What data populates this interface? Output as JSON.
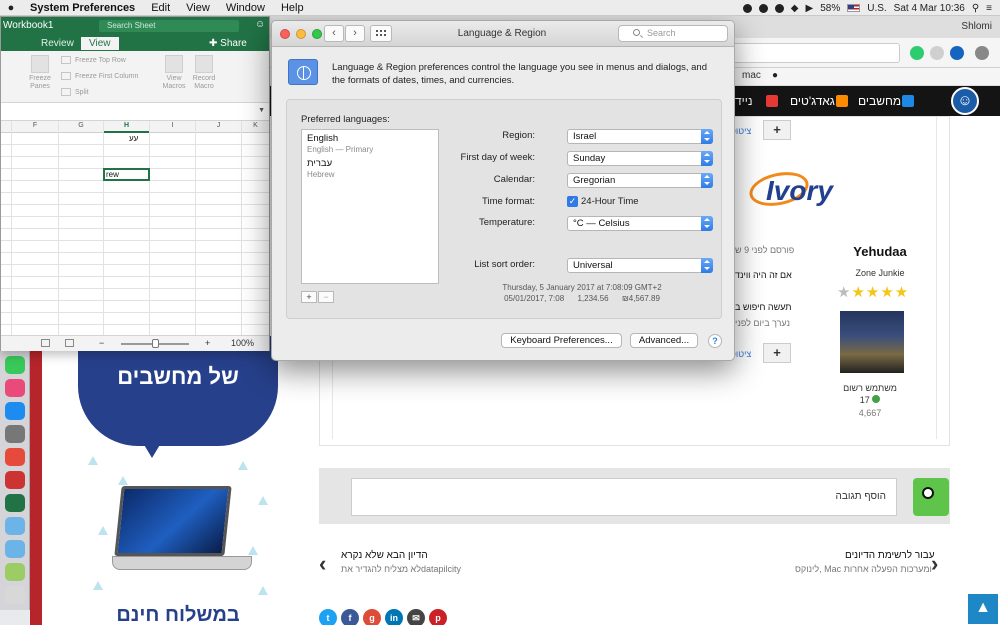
{
  "menubar": {
    "app_name": "System Preferences",
    "items": [
      "Edit",
      "View",
      "Window",
      "Help"
    ],
    "battery": "58%",
    "input_source": "U.S.",
    "datetime": "Sat 4 Mar  10:36"
  },
  "browser": {
    "user": "Shlomi",
    "bookmark": "mac",
    "nav": {
      "computers": "מחשבים",
      "gadgets": "גאדג'טים",
      "mobile": "ניידים"
    },
    "post": {
      "quote_link": "ציטוט",
      "author": "Yehudaa",
      "rank": "Zone Junkie",
      "member_status": "משתמש רשום",
      "reputation": "17",
      "post_count": "4,667",
      "meta": "פורסם לפני 9 ש",
      "line1": "אם זה היה ווינד",
      "line2": "תעשה חיפוש ב",
      "line3": "נערך ביום לפני"
    },
    "reply_placeholder": "הוסף תגובה",
    "pager": {
      "next_title": "עבור לרשימת הדיונים",
      "next_sub": "לינוקס, Mac ומערכות הפעלה אחרות",
      "prev_title": "הדיון הבא שלא נקרא",
      "prev_sub": "לא מצליח להגדיר אתdatapilcity"
    },
    "promo": {
      "top_text": "של מחשבים",
      "bottom_text": "במשלוח חינם"
    },
    "ivory_logo": "Ivory"
  },
  "excel": {
    "title": "Workbook1",
    "search_placeholder": "Search Sheet",
    "tabs": [
      "Review",
      "View"
    ],
    "share_label": "Share",
    "ribbon": {
      "freeze_panes": "Freeze Panes",
      "freeze_top_row": "Freeze Top Row",
      "freeze_first_column": "Freeze First Column",
      "split": "Split",
      "view_macros": "View Macros",
      "record_macro": "Record Macro"
    },
    "columns": [
      "F",
      "G",
      "H",
      "I",
      "J",
      "K"
    ],
    "cells": {
      "hebrew": "עע",
      "rew": "rew"
    },
    "zoom": "100%"
  },
  "prefs": {
    "window_title": "Language & Region",
    "search_placeholder": "Search",
    "description": "Language & Region preferences control the language you see in menus and dialogs, and the formats of dates, times, and currencies.",
    "preferred_languages_label": "Preferred languages:",
    "languages": [
      {
        "name": "English",
        "sub": "English — Primary"
      },
      {
        "name": "עברית",
        "sub": "Hebrew"
      }
    ],
    "fields": {
      "region_label": "Region:",
      "region_value": "Israel",
      "first_day_label": "First day of week:",
      "first_day_value": "Sunday",
      "calendar_label": "Calendar:",
      "calendar_value": "Gregorian",
      "time_format_label": "Time format:",
      "time_format_option": "24-Hour Time",
      "temperature_label": "Temperature:",
      "temperature_value": "°C — Celsius",
      "sort_order_label": "List sort order:",
      "sort_order_value": "Universal"
    },
    "sample_line1": "Thursday, 5 January 2017 at 7:08:09 GMT+2",
    "sample_line2": "05/01/2017, 7:08      1,234.56      ₪4,567.89",
    "keyboard_button": "Keyboard Preferences...",
    "advanced_button": "Advanced...",
    "help_label": "?"
  }
}
